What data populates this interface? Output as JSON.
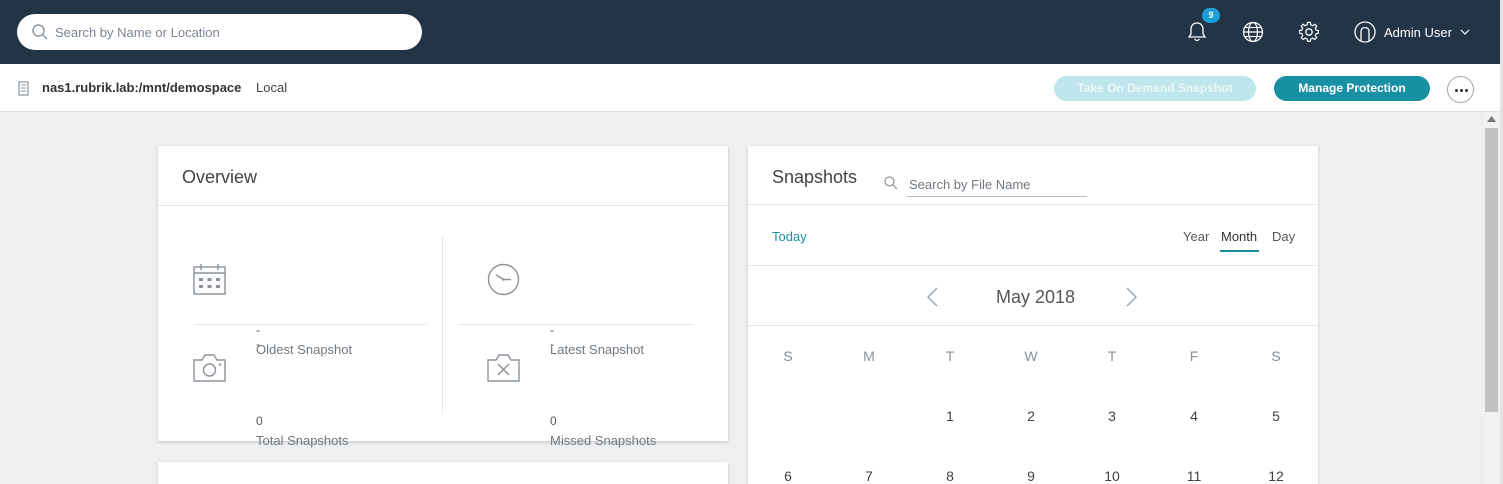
{
  "topbar": {
    "search_placeholder": "Search by Name or Location",
    "notification_count": "9",
    "user_name": "Admin User",
    "icons": [
      "search-icon",
      "bell-icon",
      "globe-icon",
      "gear-icon",
      "user-avatar-icon",
      "chevron-down-icon"
    ]
  },
  "subbar": {
    "path": "nas1.rubrik.lab:/mnt/demospace",
    "location": "Local",
    "on_demand_label": "Take On Demand Snapshot",
    "manage_label": "Manage Protection"
  },
  "overview": {
    "title": "Overview",
    "stats": [
      {
        "value": "--",
        "label": "Oldest Snapshot",
        "icon": "calendar-icon"
      },
      {
        "value": "--",
        "label": "Latest Snapshot",
        "icon": "clock-icon"
      },
      {
        "value": "0",
        "label": "Total Snapshots",
        "icon": "camera-icon"
      },
      {
        "value": "0",
        "label": "Missed Snapshots",
        "icon": "camera-missed-icon"
      }
    ]
  },
  "snapshots": {
    "title": "Snapshots",
    "search_placeholder": "Search by File Name",
    "today_label": "Today",
    "views": [
      "Year",
      "Month",
      "Day"
    ],
    "active_view": "Month",
    "month_label": "May 2018",
    "weekdays": [
      "S",
      "M",
      "T",
      "W",
      "T",
      "F",
      "S"
    ],
    "week1": [
      "",
      "",
      "1",
      "2",
      "3",
      "4",
      "5"
    ],
    "week2": [
      "6",
      "7",
      "8",
      "9",
      "10",
      "11",
      "12"
    ]
  },
  "colors": {
    "topbar": "#233447",
    "accent": "#1790a4",
    "badge": "#1a9fd9",
    "disabled_button": "#bfe6ec"
  }
}
